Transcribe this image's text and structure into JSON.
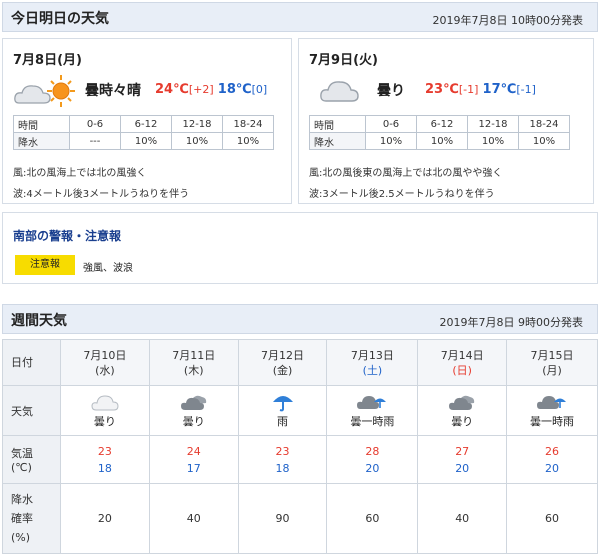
{
  "today_section": {
    "title": "今日明日の天気",
    "published": "2019年7月8日 10時00分発表",
    "days": [
      {
        "date": "7月8日(月)",
        "weather": "曇時々晴",
        "icon": "cloud-sun-icon",
        "high": "24℃",
        "high_diff": "[+2]",
        "low": "18℃",
        "low_diff": "[0]",
        "precip_table": {
          "row_label_time": "時間",
          "row_label_precip": "降水",
          "times": [
            "0-6",
            "6-12",
            "12-18",
            "18-24"
          ],
          "values": [
            "---",
            "10%",
            "10%",
            "10%"
          ]
        },
        "wind": "風:北の風海上では北の風強く",
        "wave": "波:4メートル後3メートルうねりを伴う"
      },
      {
        "date": "7月9日(火)",
        "weather": "曇り",
        "icon": "cloud-icon",
        "high": "23℃",
        "high_diff": "[-1]",
        "low": "17℃",
        "low_diff": "[-1]",
        "precip_table": {
          "row_label_time": "時間",
          "row_label_precip": "降水",
          "times": [
            "0-6",
            "6-12",
            "12-18",
            "18-24"
          ],
          "values": [
            "10%",
            "10%",
            "10%",
            "10%"
          ]
        },
        "wind": "風:北の風後東の風海上では北の風やや強く",
        "wave": "波:3メートル後2.5メートルうねりを伴う"
      }
    ]
  },
  "warnings": {
    "title": "南部の警報・注意報",
    "badge": "注意報",
    "text": "強風、波浪",
    "badge_color": "#f7dc00"
  },
  "weekly": {
    "title": "週間天気",
    "published": "2019年7月8日 9時00分発表",
    "row_labels": {
      "date": "日付",
      "weather": "天気",
      "temp_line1": "気温",
      "temp_line2": "(℃)",
      "rain_line1": "降水",
      "rain_line2": "確率",
      "rain_line3": "(%)"
    },
    "days": [
      {
        "date": "7月10日",
        "dow": "(水)",
        "dow_type": "weekday",
        "weather": "曇り",
        "icon": "cloud-icon-light",
        "high": "23",
        "low": "18",
        "rain": "20"
      },
      {
        "date": "7月11日",
        "dow": "(木)",
        "dow_type": "weekday",
        "weather": "曇り",
        "icon": "cloud-icon",
        "high": "24",
        "low": "17",
        "rain": "40"
      },
      {
        "date": "7月12日",
        "dow": "(金)",
        "dow_type": "weekday",
        "weather": "雨",
        "icon": "umbrella-icon",
        "high": "23",
        "low": "18",
        "rain": "90"
      },
      {
        "date": "7月13日",
        "dow": "(土)",
        "dow_type": "sat",
        "weather": "曇一時雨",
        "icon": "cloud-umbrella-icon",
        "high": "28",
        "low": "20",
        "rain": "60"
      },
      {
        "date": "7月14日",
        "dow": "(日)",
        "dow_type": "sun",
        "weather": "曇り",
        "icon": "cloud-icon",
        "high": "27",
        "low": "20",
        "rain": "40"
      },
      {
        "date": "7月15日",
        "dow": "(月)",
        "dow_type": "weekday",
        "weather": "曇一時雨",
        "icon": "cloud-umbrella-icon",
        "high": "26",
        "low": "20",
        "rain": "60"
      }
    ]
  }
}
